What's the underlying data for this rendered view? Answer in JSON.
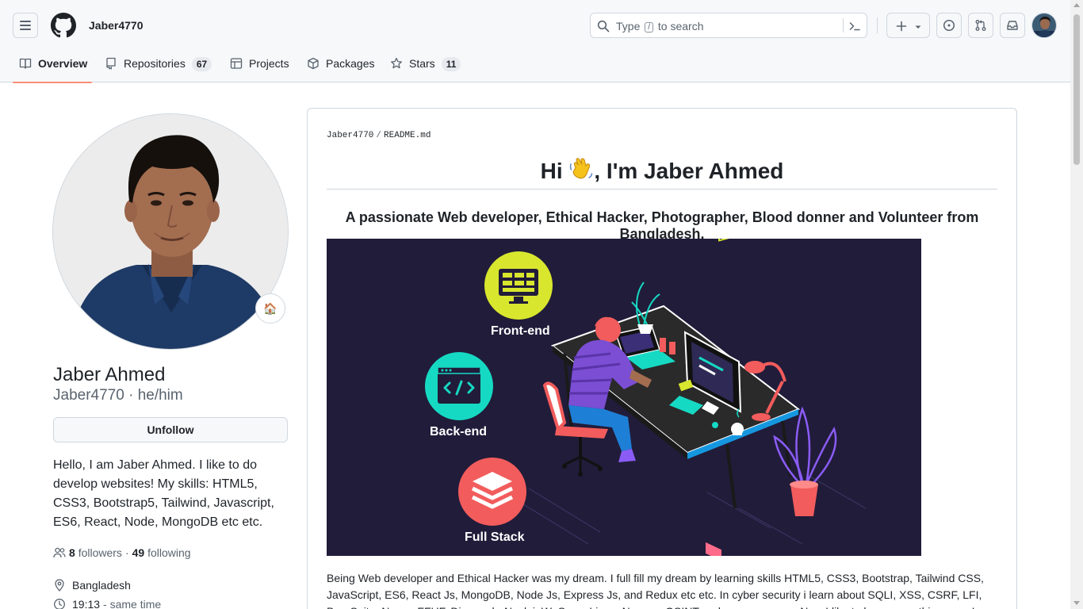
{
  "header": {
    "username": "Jaber4770",
    "search": {
      "placeholder_before": "Type",
      "kbd": "/",
      "placeholder_after": "to search"
    },
    "icons": [
      "menu-icon",
      "github-logo-icon",
      "search-icon",
      "command-palette-icon",
      "plus-icon",
      "chevron-down-icon",
      "issues-icon",
      "pull-requests-icon",
      "inbox-icon"
    ]
  },
  "tabs": [
    {
      "label": "Overview",
      "icon": "book-icon",
      "active": true
    },
    {
      "label": "Repositories",
      "icon": "repo-icon",
      "count": "67"
    },
    {
      "label": "Projects",
      "icon": "table-icon"
    },
    {
      "label": "Packages",
      "icon": "package-icon"
    },
    {
      "label": "Stars",
      "icon": "star-icon",
      "count": "11"
    }
  ],
  "profile": {
    "name": "Jaber Ahmed",
    "login": "Jaber4770",
    "pronouns": "he/him",
    "separator": "·",
    "status_emoji": "🏠",
    "unfollow_label": "Unfollow",
    "bio": "Hello, I am Jaber Ahmed. I like to do develop websites! My skills: HTML5, CSS3, Bootstrap5, Tailwind, Javascript, ES6, React, Node, MongoDB etc etc.",
    "followers_count": "8",
    "followers_label": "followers",
    "dot": "·",
    "following_count": "49",
    "following_label": "following",
    "location": "Bangladesh",
    "local_time": "19:13",
    "local_time_suffix": "- same time"
  },
  "readme": {
    "path_user": "Jaber4770",
    "path_sep": "/",
    "path_file": "README.md",
    "title_before": "Hi",
    "title_emoji": "👋",
    "title_after": ", I'm Jaber Ahmed",
    "subtitle": "A passionate Web developer, Ethical Hacker, Photographer, Blood donner and Volunteer from Bangladesh.",
    "banner": {
      "background": "#211c3a",
      "labels": [
        "Front-end",
        "Back-end",
        "Full Stack"
      ],
      "colors": {
        "frontend": "#d8e62e",
        "backend": "#16d9c3",
        "fullstack": "#f25c5c"
      }
    },
    "body": "Being Web developer and Ethical Hacker was my dream. I full fill my dream by learning skills HTML5, CSS3, Bootstrap, Tailwind CSS, JavaScript, ES6, React Js, MongoDB, Node Js, Express Js, and Redux etc etc. In cyber security i learn about SQLI, XSS, CSRF, LFI, BurpSuite, Nmap, FFUF, Dirsearch, Nuclei, WpScan, Linux, Nessus, OSINT and so many more. Now I like to learn something new. I love learning daily..."
  },
  "colors": {
    "accent_underline": "#fd8c73",
    "border": "#d0d7de",
    "muted_text": "#59636e",
    "header_bg": "#f6f8fa"
  }
}
